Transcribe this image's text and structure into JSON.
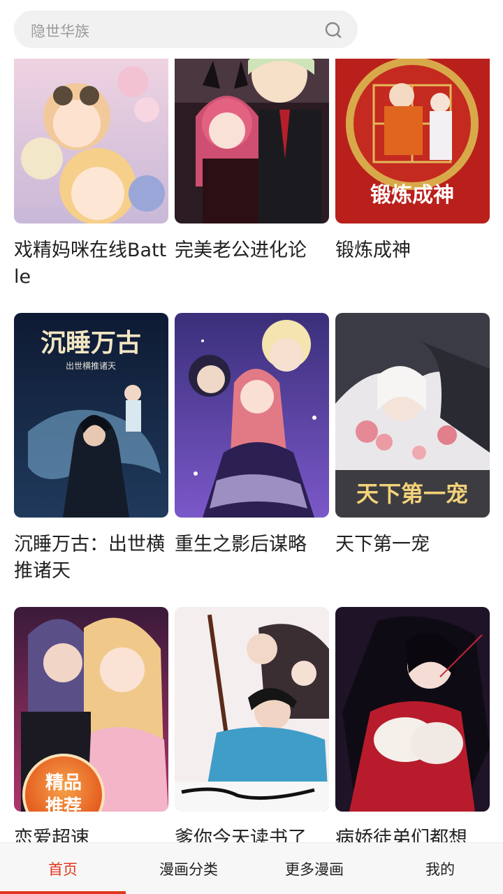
{
  "search": {
    "placeholder": "隐世华族"
  },
  "comics": [
    {
      "title": "戏精妈咪在线Battle"
    },
    {
      "title": "完美老公进化论"
    },
    {
      "title": "锻炼成神",
      "cover_text": "锻炼成神"
    },
    {
      "title": "沉睡万古：出世横推诸天",
      "cover_text": "沉睡万古",
      "cover_subtext": "出世横推诸天"
    },
    {
      "title": "重生之影后谋略"
    },
    {
      "title": "天下第一宠",
      "cover_text": "天下第一宠"
    },
    {
      "title": "恋爱超速",
      "badge_line1": "精品",
      "badge_line2": "推荐"
    },
    {
      "title": "爹你今天读书了"
    },
    {
      "title": "病娇徒弟们都想"
    }
  ],
  "tabs": [
    {
      "label": "首页",
      "active": true
    },
    {
      "label": "漫画分类"
    },
    {
      "label": "更多漫画"
    },
    {
      "label": "我的"
    }
  ],
  "colors": {
    "accent": "#e2361f",
    "search_bg": "#f1f1f1"
  }
}
